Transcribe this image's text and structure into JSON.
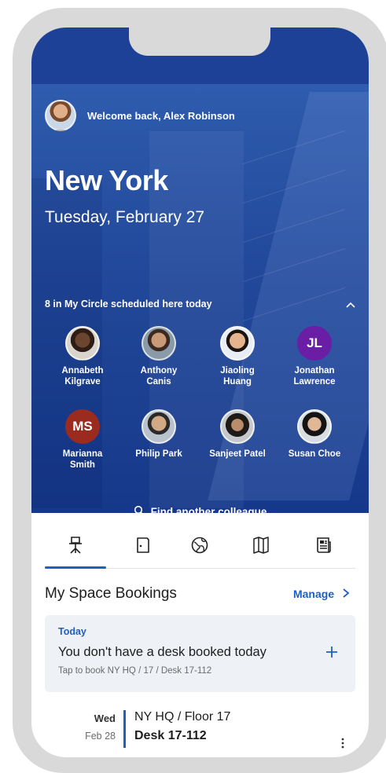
{
  "header": {
    "welcome": "Welcome back, Alex Robinson",
    "city": "New York",
    "date": "Tuesday, February 27"
  },
  "circle": {
    "heading": "8 in My Circle scheduled here today",
    "people": [
      {
        "line1": "Annabeth",
        "line2": "Kilgrave",
        "avatar": "photo",
        "initials": ""
      },
      {
        "line1": "Anthony",
        "line2": "Canis",
        "avatar": "photo",
        "initials": ""
      },
      {
        "line1": "Jiaoling",
        "line2": "Huang",
        "avatar": "photo",
        "initials": ""
      },
      {
        "line1": "Jonathan",
        "line2": "Lawrence",
        "avatar": "initials",
        "initials": "JL",
        "color": "#6a1ea5"
      },
      {
        "line1": "Marianna",
        "line2": "Smith",
        "avatar": "initials",
        "initials": "MS",
        "color": "#9b2b1e"
      },
      {
        "line1": "Philip Park",
        "line2": "",
        "avatar": "photo",
        "initials": ""
      },
      {
        "line1": "Sanjeet Patel",
        "line2": "",
        "avatar": "photo",
        "initials": ""
      },
      {
        "line1": "Susan Choe",
        "line2": "",
        "avatar": "photo",
        "initials": ""
      }
    ],
    "find": "Find another colleague"
  },
  "tabs": [
    {
      "icon": "desk-chair-icon",
      "active": true
    },
    {
      "icon": "door-icon",
      "active": false
    },
    {
      "icon": "globe-icon",
      "active": false
    },
    {
      "icon": "map-icon",
      "active": false
    },
    {
      "icon": "news-icon",
      "active": false
    }
  ],
  "bookings": {
    "title": "My Space Bookings",
    "manage": "Manage",
    "today_card": {
      "label": "Today",
      "message": "You don't have a desk booked today",
      "hint": "Tap to book NY HQ / 17 / Desk 17-112"
    },
    "upcoming": {
      "day": "Wed",
      "date": "Feb 28",
      "location": "NY HQ / Floor 17",
      "desk": "Desk 17-112"
    }
  },
  "colors": {
    "accent": "#1f5fbf",
    "hero": "#21489a"
  }
}
